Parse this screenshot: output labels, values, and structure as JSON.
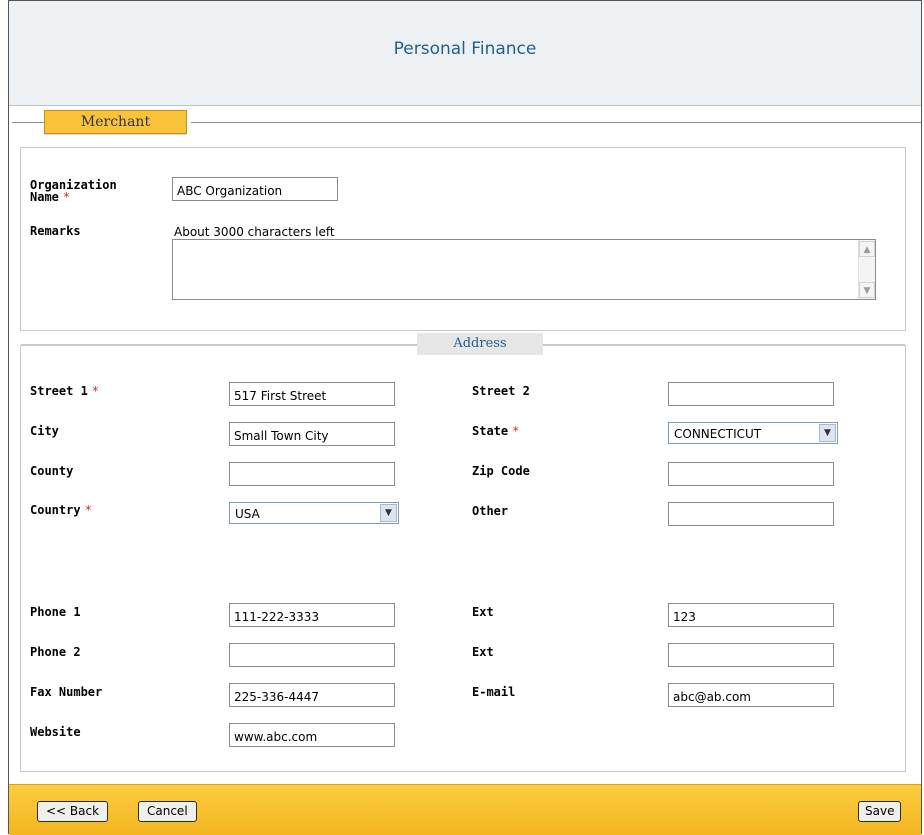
{
  "header": {
    "title": "Personal Finance"
  },
  "tabs": {
    "merchant": "Merchant",
    "address": "Address"
  },
  "merchant": {
    "org_name_label": "Organization Name",
    "org_name_value": "ABC Organization",
    "remarks_label": "Remarks",
    "remarks_hint": "About 3000 characters left",
    "remarks_value": ""
  },
  "address": {
    "street1_label": "Street 1",
    "street1_value": "517 First Street",
    "street2_label": "Street 2",
    "street2_value": "",
    "city_label": "City",
    "city_value": "Small Town City",
    "state_label": "State",
    "state_value": "CONNECTICUT",
    "county_label": "County",
    "county_value": "",
    "zip_label": "Zip Code",
    "zip_value": "",
    "country_label": "Country",
    "country_value": "USA",
    "other_label": "Other",
    "other_value": "",
    "phone1_label": "Phone 1",
    "phone1_value": "111-222-3333",
    "ext1_label": "Ext",
    "ext1_value": "123",
    "phone2_label": "Phone 2",
    "phone2_value": "",
    "ext2_label": "Ext",
    "ext2_value": "",
    "fax_label": "Fax Number",
    "fax_value": "225-336-4447",
    "email_label": "E-mail",
    "email_value": "abc@ab.com",
    "website_label": "Website",
    "website_value": "www.abc.com"
  },
  "required_mark": "*",
  "footer": {
    "back_label": "<< Back",
    "cancel_label": "Cancel",
    "save_label": "Save"
  },
  "colors": {
    "accent": "#f8c23a",
    "title": "#1f5f93",
    "required": "#e02020"
  }
}
